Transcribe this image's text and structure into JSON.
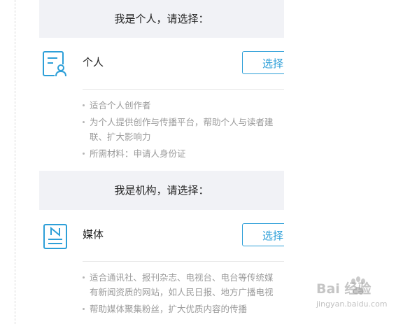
{
  "personal_section": {
    "header": "我是个人，请选择：",
    "option": {
      "icon": "person-document-icon",
      "title": "个人",
      "button_label": "选择",
      "bullets": [
        "适合个人创作者",
        "为个人提供创作与传播平台，帮助个人与读者建",
        "联、扩大影响力",
        "所需材料：申请人身份证"
      ]
    }
  },
  "org_section": {
    "header": "我是机构，请选择：",
    "option": {
      "icon": "news-document-icon",
      "title": "媒体",
      "button_label": "选择",
      "bullets": [
        "适合通讯社、报刊杂志、电视台、电台等传统媒",
        "有新闻资质的网站，如人民日报、地方广播电视",
        "帮助媒体聚集粉丝，扩大优质内容的传播"
      ]
    }
  },
  "watermark": {
    "brand": "Bai 经验",
    "url": "jingyan.baidu.com"
  },
  "colors": {
    "accent": "#2d9fd8",
    "header_bg": "#f1f2f6",
    "muted_text": "#9a9a9a",
    "divider": "#e6e6e6"
  }
}
